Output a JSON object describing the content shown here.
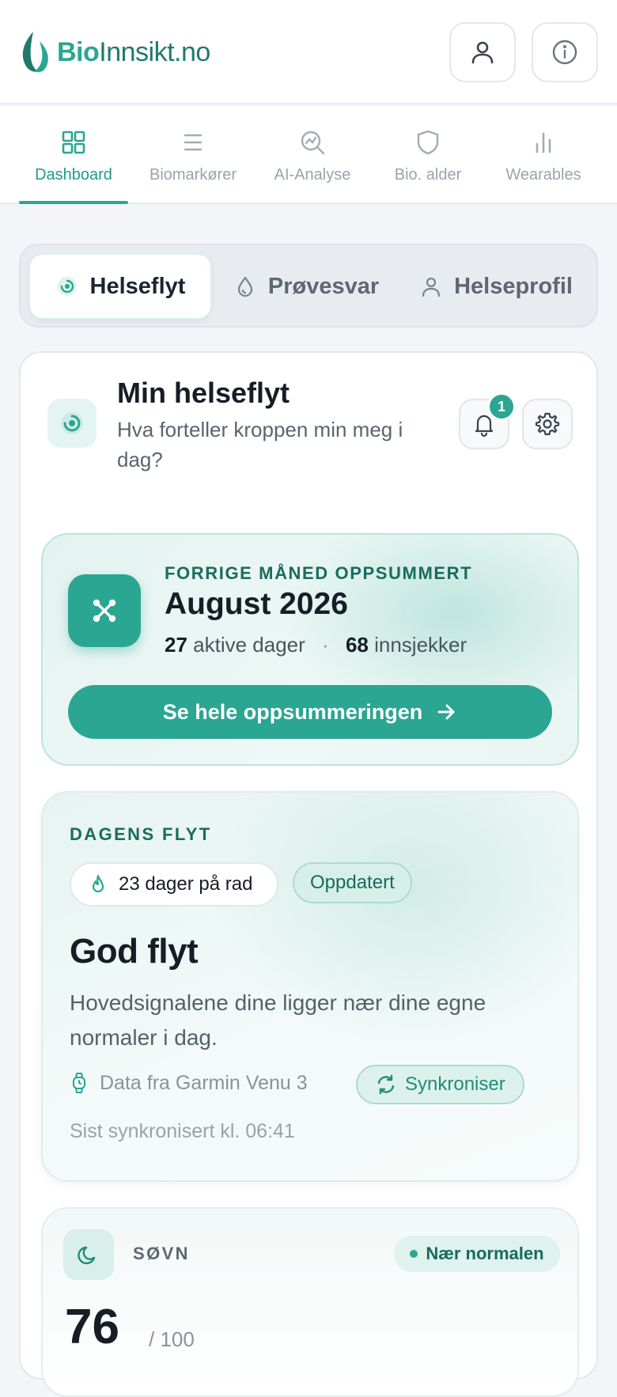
{
  "app": {
    "brand_bio": "Bio",
    "brand_rest": "Innsikt.no"
  },
  "nav": {
    "tabs": [
      {
        "label": "Dashboard",
        "icon": "grid-icon",
        "active": true
      },
      {
        "label": "Biomarkører",
        "icon": "list-icon"
      },
      {
        "label": "AI-Analyse",
        "icon": "analysis-icon"
      },
      {
        "label": "Bio. alder",
        "icon": "shield-icon"
      },
      {
        "label": "Wearables",
        "icon": "bar-chart-icon"
      }
    ]
  },
  "segments": [
    {
      "label": "Helseflyt",
      "active": true
    },
    {
      "label": "Prøvesvar"
    },
    {
      "label": "Helseprofil"
    }
  ],
  "helseflyt": {
    "title": "Min helseflyt",
    "subtitle": "Hva forteller kroppen min meg i dag?",
    "notification_count": "1"
  },
  "summary": {
    "kicker": "FORRIGE MÅNED OPPSUMMERT",
    "title": "August 2026",
    "active_days": "27",
    "active_days_label": "aktive dager",
    "separator": "·",
    "checkins": "68",
    "checkins_label": "innsjekker",
    "button_label": "Se hele oppsummeringen"
  },
  "daily_flow": {
    "kicker": "DAGENS FLYT",
    "streak": "23 dager på rad",
    "status_pill": "Oppdatert",
    "title": "God flyt",
    "description": "Hovedsignalene dine ligger nær dine egne normaler i dag.",
    "source": "Data fra Garmin Venu 3",
    "sync_button": "Synkroniser",
    "last_sync": "Sist synkronisert kl. 06:41"
  },
  "sleep": {
    "label": "SØVN",
    "status": "Nær normalen",
    "score": "76",
    "max": "/ 100"
  },
  "colors": {
    "accent": "#2aa692",
    "accent_dark": "#1a6b5e",
    "background": "#f3f5f8"
  }
}
